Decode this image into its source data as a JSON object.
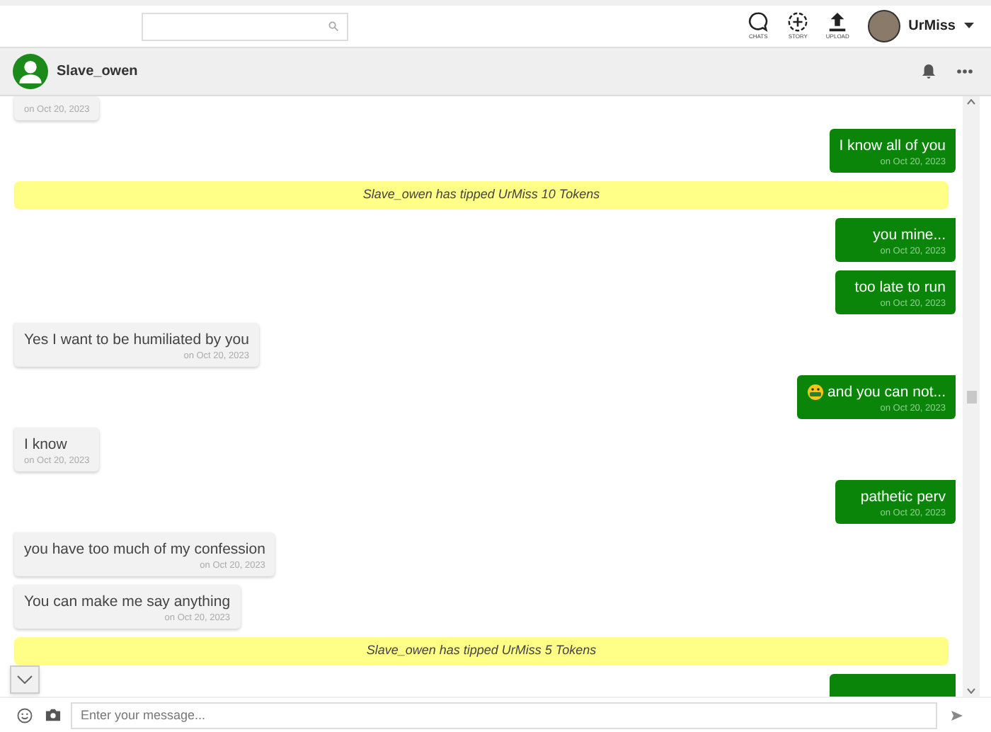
{
  "top_bar": {
    "nav": [
      {
        "kind": "chats",
        "label": "CHATS"
      },
      {
        "kind": "story",
        "label": "STORY"
      },
      {
        "kind": "upload",
        "label": "UPLOAD"
      }
    ],
    "user": {
      "name": "UrMiss"
    }
  },
  "conversation": {
    "name": "Slave_owen"
  },
  "messages": [
    {
      "kind": "incoming",
      "date": "on Oct 20, 2023"
    },
    {
      "kind": "outgoing",
      "text": "I know all of you",
      "date": "on Oct 20, 2023"
    },
    {
      "kind": "tip",
      "text": "Slave_owen has tipped UrMiss 10 Tokens"
    },
    {
      "kind": "outgoing",
      "text": "you mine...",
      "date": "on Oct 20, 2023"
    },
    {
      "kind": "outgoing",
      "text": "too late to run",
      "date": "on Oct 20, 2023"
    },
    {
      "kind": "incoming",
      "text": "Yes I want to be humiliated by you",
      "date": "on Oct 20, 2023"
    },
    {
      "kind": "outgoing",
      "text": "and you can not...",
      "date": "on Oct 20, 2023",
      "emoji": true
    },
    {
      "kind": "incoming",
      "text": "I know",
      "date": "on Oct 20, 2023"
    },
    {
      "kind": "outgoing",
      "text": "pathetic perv",
      "date": "on Oct 20, 2023"
    },
    {
      "kind": "incoming",
      "text": "you have too much of my confession",
      "date": "on Oct 20, 2023"
    },
    {
      "kind": "incoming",
      "text": "You can make me say anything",
      "date": "on Oct 20, 2023"
    },
    {
      "kind": "tip",
      "text": "Slave_owen has tipped UrMiss 5 Tokens"
    },
    {
      "kind": "outgoing"
    }
  ],
  "composer": {
    "placeholder": "Enter your message..."
  }
}
